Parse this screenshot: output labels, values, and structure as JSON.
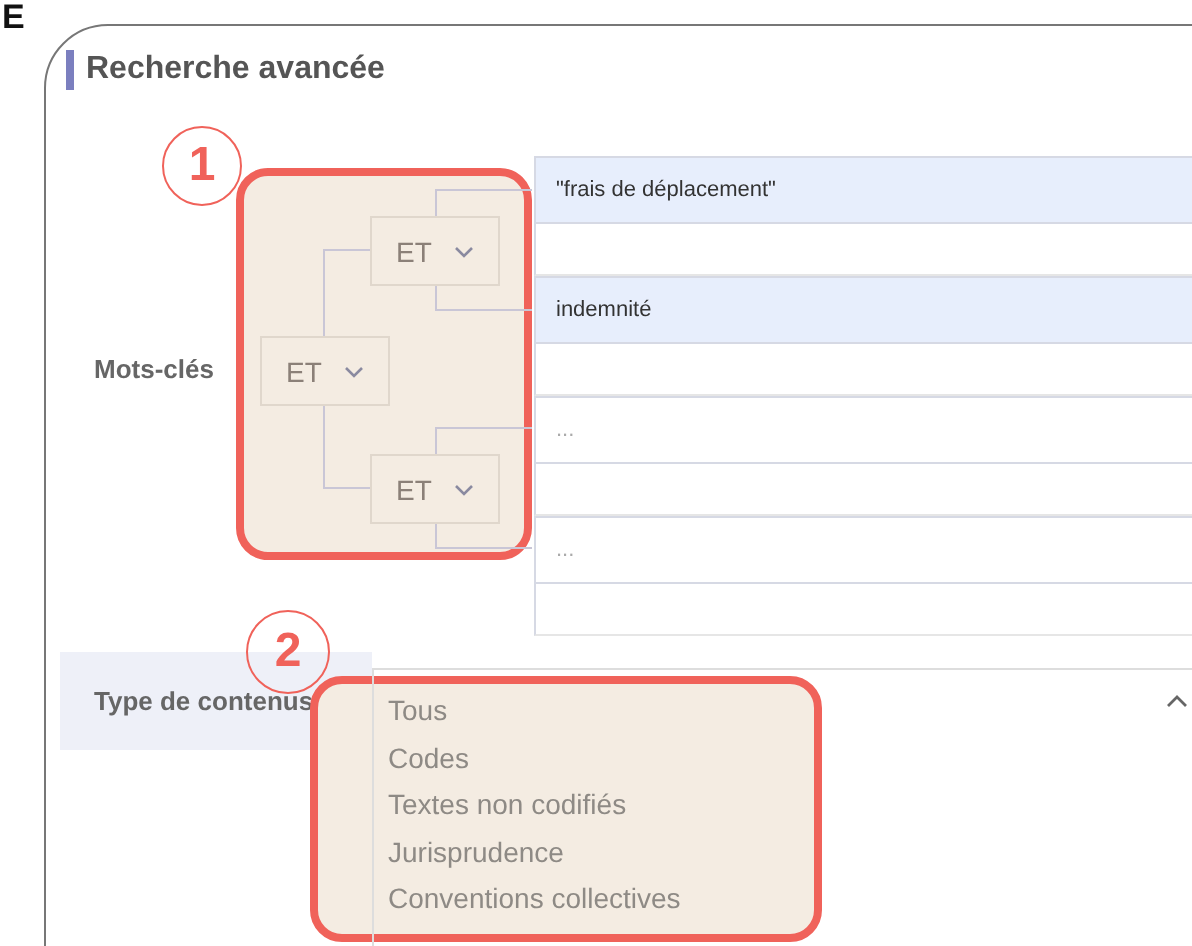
{
  "figure_label": "E",
  "panel": {
    "title": "Recherche avancée"
  },
  "keywords": {
    "label": "Mots-clés",
    "callout": "1",
    "tree": {
      "operator": "ET",
      "children": [
        {
          "operator": "ET",
          "children": [
            {
              "value": "\"frais de déplacement\""
            },
            {
              "value": "indemnité"
            }
          ]
        },
        {
          "operator": "ET",
          "children": [
            {
              "placeholder": "..."
            },
            {
              "placeholder": "..."
            }
          ]
        }
      ]
    }
  },
  "content_type": {
    "label": "Type de contenus",
    "callout": "2",
    "expanded": true,
    "options": [
      "Tous",
      "Codes",
      "Textes non codifiés",
      "Jurisprudence",
      "Conventions collectives"
    ]
  }
}
